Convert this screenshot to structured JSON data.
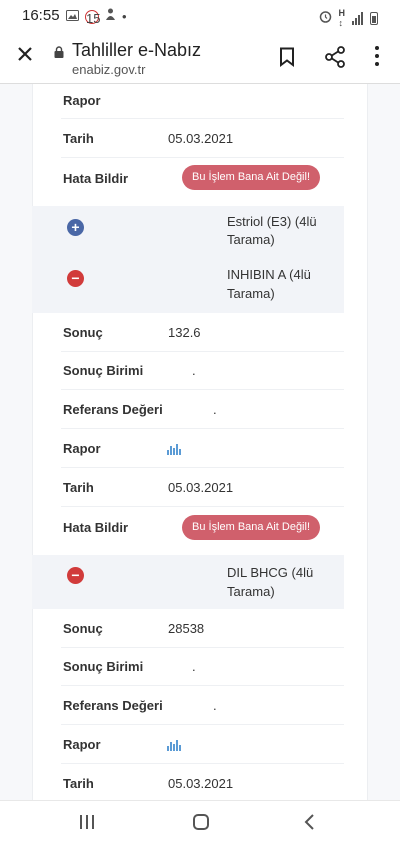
{
  "status_bar": {
    "time": "16:55",
    "left_icons": [
      "gallery-icon",
      "notification-badge-icon",
      "phone-icon",
      "dot-icon"
    ],
    "right_icons": [
      "alarm-icon",
      "network-icon",
      "signal-icon",
      "battery-icon"
    ]
  },
  "toolbar": {
    "title": "Tahliller e-Nabız",
    "url": "enabiz.gov.tr",
    "close_icon": "close-icon",
    "bookmark_icon": "bookmark-icon",
    "share_icon": "share-icon",
    "more_icon": "more-vert-icon"
  },
  "labels": {
    "rapor": "Rapor",
    "tarih": "Tarih",
    "hata_bildir": "Hata Bildir",
    "sonuc": "Sonuç",
    "sonuc_birimi": "Sonuç Birimi",
    "referans_degeri": "Referans Değeri",
    "error_button": "Bu İşlem Bana Ait Değil!"
  },
  "top_section": {
    "tarih": "05.03.2021"
  },
  "groups": [
    {
      "name": "Estriol (E3) (4lü Tarama)",
      "line1": "Estriol (E3) (4lü",
      "line2": "Tarama)",
      "state": "collapsed"
    },
    {
      "name": "INHIBIN A (4lü Tarama)",
      "line1": "INHIBIN A (4lü",
      "line2": "Tarama)",
      "state": "expanded",
      "sonuc": "132.6",
      "sonuc_birimi": ".",
      "referans_degeri": ".",
      "tarih": "05.03.2021"
    },
    {
      "name": "DIL BHCG (4lü Tarama)",
      "line1": "DIL BHCG (4lü",
      "line2": "Tarama)",
      "state": "expanded",
      "sonuc": "28538",
      "sonuc_birimi": ".",
      "referans_degeri": ".",
      "tarih": "05.03.2021"
    }
  ],
  "colors": {
    "expand_icon": "#4a67a6",
    "collapse_icon": "#d13b3b",
    "error_button": "#d0606c",
    "report_icon": "#5b9bd5"
  }
}
